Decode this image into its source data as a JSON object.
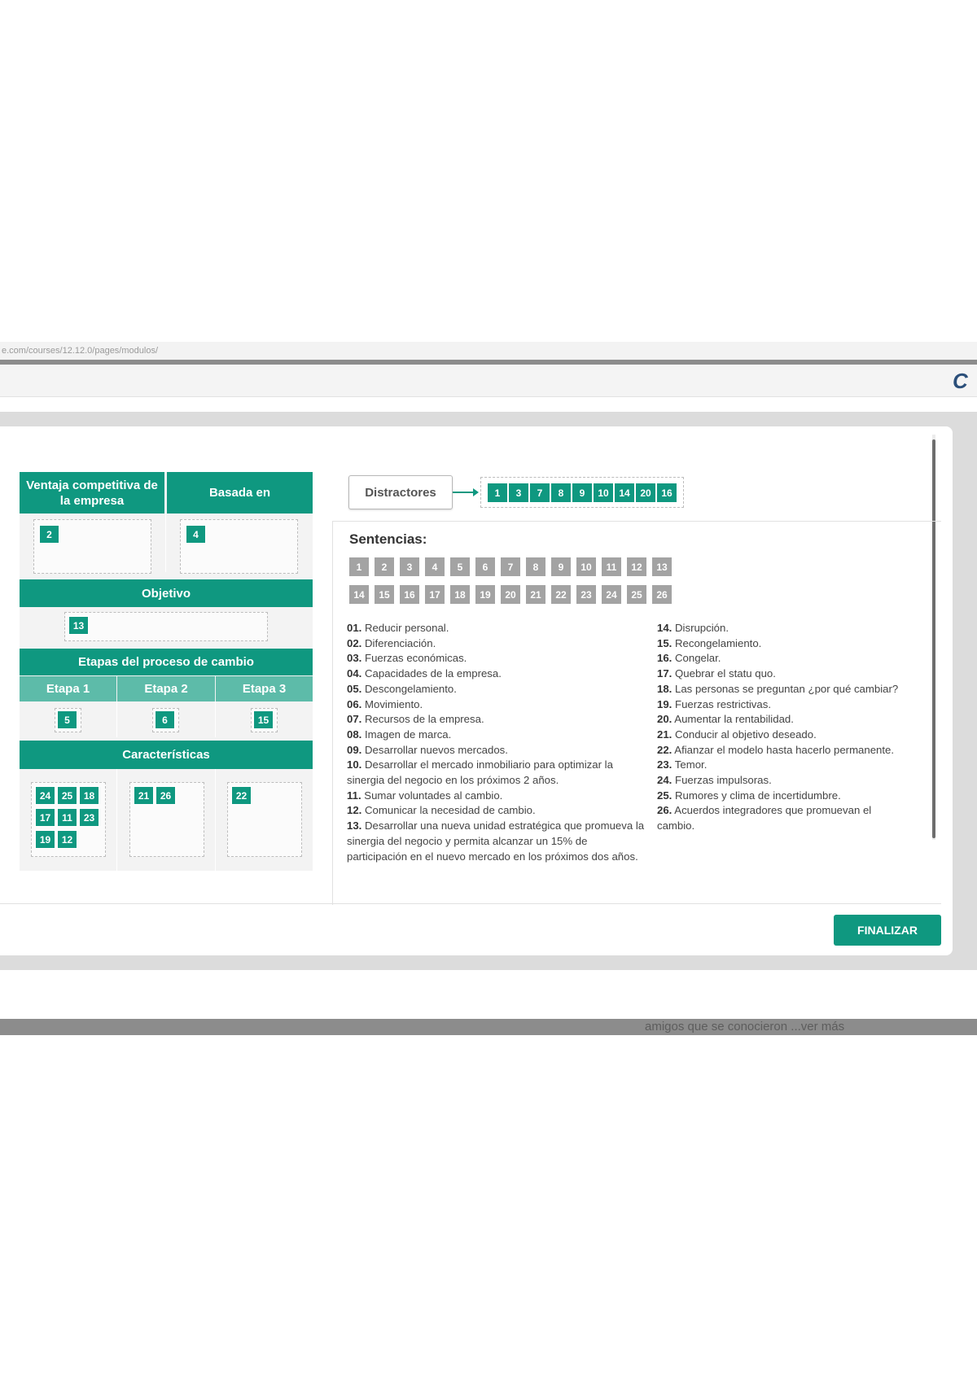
{
  "browser": {
    "url_fragment": "e.com/courses/12.12.0/pages/modulos/"
  },
  "board": {
    "header_competitive": "Ventaja competitiva de la empresa",
    "header_based_on": "Basada en",
    "competitive_chip": "2",
    "based_on_chip": "4",
    "header_objective": "Objetivo",
    "objective_chip": "13",
    "header_stages": "Etapas del proceso de cambio",
    "stage1_label": "Etapa 1",
    "stage2_label": "Etapa 2",
    "stage3_label": "Etapa 3",
    "stage1_chip": "5",
    "stage2_chip": "6",
    "stage3_chip": "15",
    "header_characteristics": "Características",
    "char1_chips": [
      "24",
      "25",
      "18",
      "17",
      "11",
      "23",
      "19",
      "12"
    ],
    "char2_chips": [
      "21",
      "26"
    ],
    "char3_chips": [
      "22"
    ]
  },
  "distractors": {
    "label": "Distractores",
    "chips": [
      "1",
      "3",
      "7",
      "8",
      "9",
      "10",
      "14",
      "20",
      "16"
    ]
  },
  "sentences": {
    "title": "Sentencias:",
    "row1": [
      "1",
      "2",
      "3",
      "4",
      "5",
      "6",
      "7",
      "8",
      "9",
      "10",
      "11",
      "12",
      "13"
    ],
    "row2": [
      "14",
      "15",
      "16",
      "17",
      "18",
      "19",
      "20",
      "21",
      "22",
      "23",
      "24",
      "25",
      "26"
    ],
    "left": [
      {
        "num": "01.",
        "text": "Reducir personal."
      },
      {
        "num": "02.",
        "text": "Diferenciación."
      },
      {
        "num": "03.",
        "text": "Fuerzas económicas."
      },
      {
        "num": "04.",
        "text": "Capacidades de la empresa."
      },
      {
        "num": "05.",
        "text": "Descongelamiento."
      },
      {
        "num": "06.",
        "text": "Movimiento."
      },
      {
        "num": "07.",
        "text": "Recursos de la empresa."
      },
      {
        "num": "08.",
        "text": "Imagen de marca."
      },
      {
        "num": "09.",
        "text": "Desarrollar nuevos mercados."
      },
      {
        "num": "10.",
        "text": "Desarrollar el mercado inmobiliario para optimizar la sinergia del negocio en los próximos 2 años."
      },
      {
        "num": "11.",
        "text": "Sumar voluntades al cambio."
      },
      {
        "num": "12.",
        "text": "Comunicar la necesidad de cambio."
      },
      {
        "num": "13.",
        "text": "Desarrollar una nueva unidad estratégica que promueva la sinergia del negocio y permita alcanzar un 15% de participación en el nuevo mercado en los próximos dos años."
      }
    ],
    "right": [
      {
        "num": "14.",
        "text": "Disrupción."
      },
      {
        "num": "15.",
        "text": "Recongelamiento."
      },
      {
        "num": "16.",
        "text": "Congelar."
      },
      {
        "num": "17.",
        "text": "Quebrar el statu quo."
      },
      {
        "num": "18.",
        "text": "Las personas se preguntan ¿por qué cambiar?"
      },
      {
        "num": "19.",
        "text": "Fuerzas restrictivas."
      },
      {
        "num": "20.",
        "text": "Aumentar la rentabilidad."
      },
      {
        "num": "21.",
        "text": "Conducir al objetivo deseado."
      },
      {
        "num": "22.",
        "text": "Afianzar el modelo hasta hacerlo permanente."
      },
      {
        "num": "23.",
        "text": "Temor."
      },
      {
        "num": "24.",
        "text": "Fuerzas impulsoras."
      },
      {
        "num": "25.",
        "text": "Rumores y clima de incertidumbre."
      },
      {
        "num": "26.",
        "text": "Acuerdos integradores que promuevan el cambio."
      }
    ]
  },
  "actions": {
    "finish_label": "FINALIZAR"
  },
  "footer": {
    "snippet": "amigos que se conocieron ...ver más"
  },
  "colors": {
    "accent": "#0f9880",
    "accent_light": "#5dbba9",
    "chip_gray": "#a3a3a3"
  }
}
